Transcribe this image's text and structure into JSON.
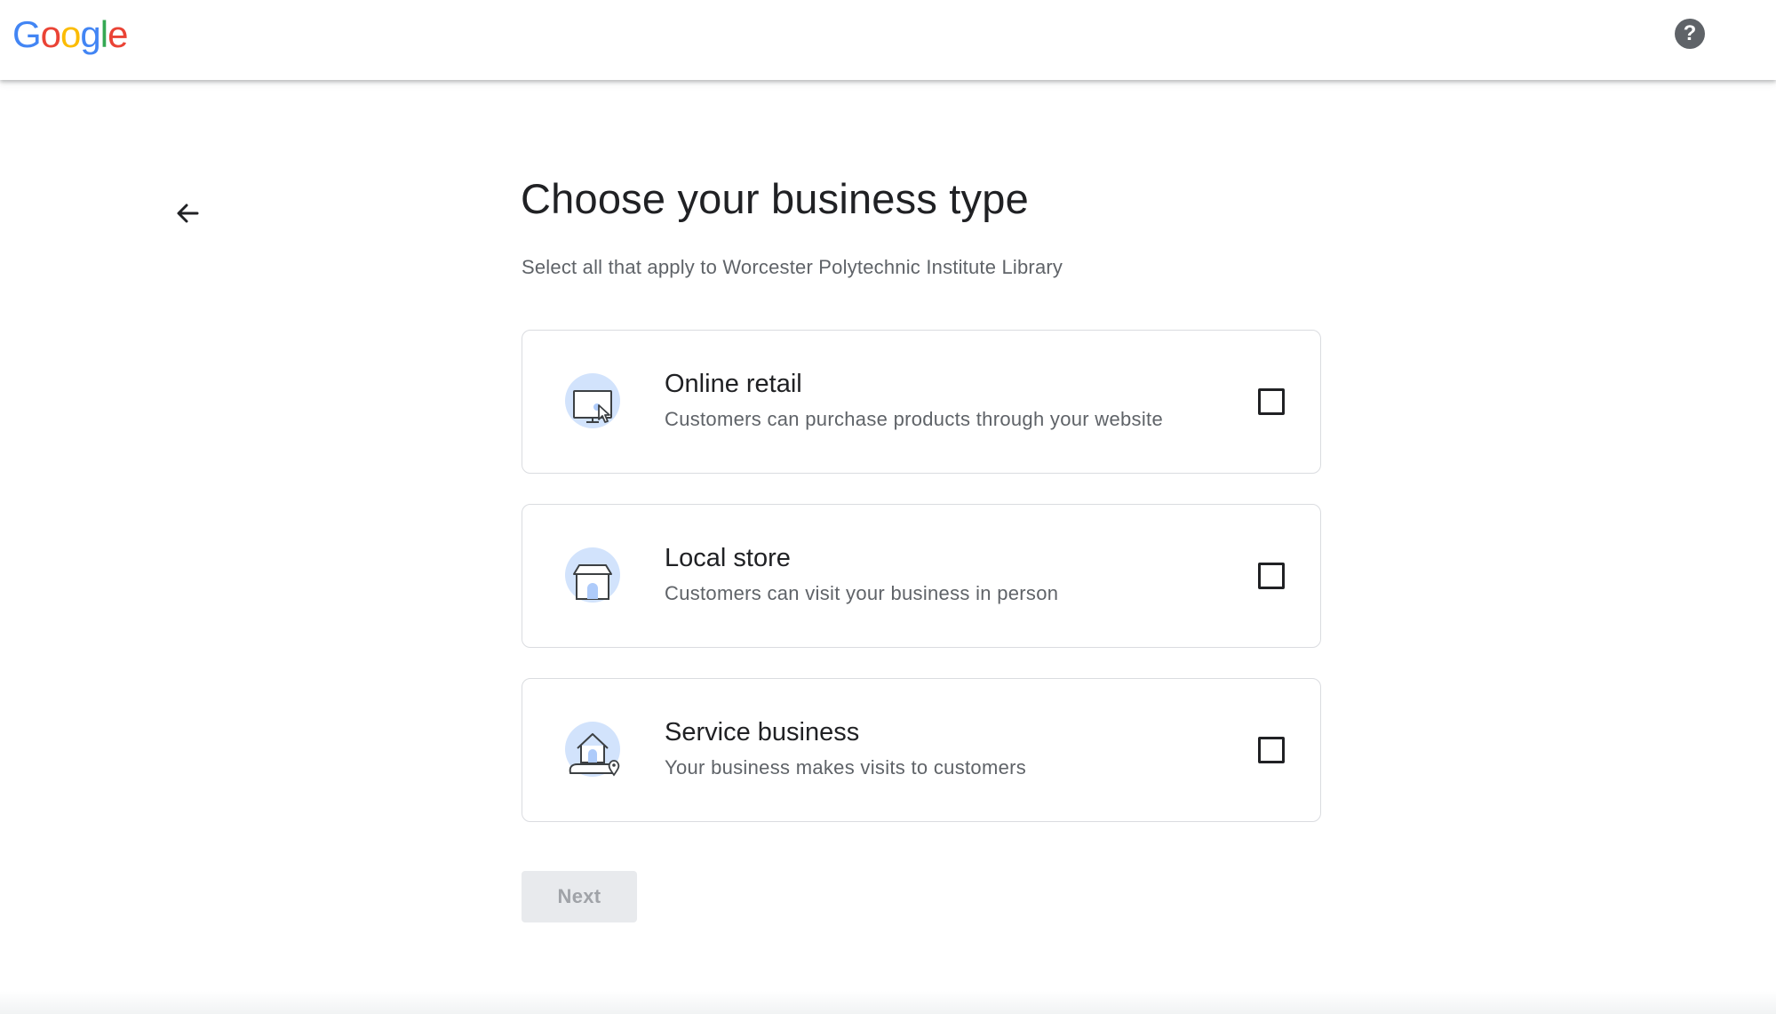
{
  "header": {
    "logo": {
      "letters": [
        "G",
        "o",
        "o",
        "g",
        "l",
        "e"
      ],
      "colors": [
        "#4285F4",
        "#EA4335",
        "#FBBC05",
        "#4285F4",
        "#34A853",
        "#EA4335"
      ]
    },
    "help_icon": "question-circle-icon",
    "help_glyph": "?"
  },
  "page": {
    "back_icon": "arrow-left-icon",
    "title": "Choose your business type",
    "subtitle": "Select all that apply to Worcester Polytechnic Institute Library"
  },
  "options": [
    {
      "icon": "online-retail-icon",
      "label": "Online retail",
      "description": "Customers can purchase products through your website",
      "checked": false
    },
    {
      "icon": "local-store-icon",
      "label": "Local store",
      "description": "Customers can visit your business in person",
      "checked": false
    },
    {
      "icon": "service-business-icon",
      "label": "Service business",
      "description": "Your business makes visits to customers",
      "checked": false
    }
  ],
  "actions": {
    "next_label": "Next",
    "next_disabled": true
  },
  "colors": {
    "accent_light": "#d2e3fc",
    "accent": "#aecbfa",
    "line": "#3c4043"
  }
}
